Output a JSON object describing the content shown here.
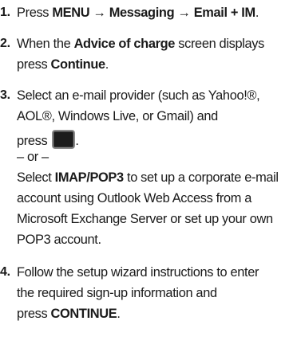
{
  "steps": [
    {
      "number": "1.",
      "parts": {
        "a": "Press ",
        "b": "MENU",
        "c": " → ",
        "d": "Messaging",
        "e": " → ",
        "f": "Email + IM",
        "g": "."
      }
    },
    {
      "number": "2.",
      "line1_pre": "When the ",
      "line1_bold": "Advice of charge",
      "line1_post": " screen displays",
      "line2_pre": "press ",
      "line2_bold": "Continue",
      "line2_post": "."
    },
    {
      "number": "3.",
      "line1": "Select an e-mail provider (such as Yahoo!®,",
      "line2": "AOL®, Windows Live, or Gmail) and",
      "line3_pre": "press",
      "line3_post": ".",
      "or_text": "– or –",
      "line5_pre": "Select ",
      "line5_bold": "IMAP/POP3",
      "line5_post": " to set up a corporate e-mail",
      "line6": "account using Outlook Web Access from a",
      "line7": "Microsoft Exchange Server or set up your own",
      "line8": "POP3 account."
    },
    {
      "number": "4.",
      "line1": "Follow the setup wizard instructions to enter",
      "line2": "the required sign-up information and",
      "line3_pre": "press ",
      "line3_bold": "CONTINUE",
      "line3_post": "."
    }
  ],
  "icons": {
    "key_button": "black-key-button-icon"
  }
}
